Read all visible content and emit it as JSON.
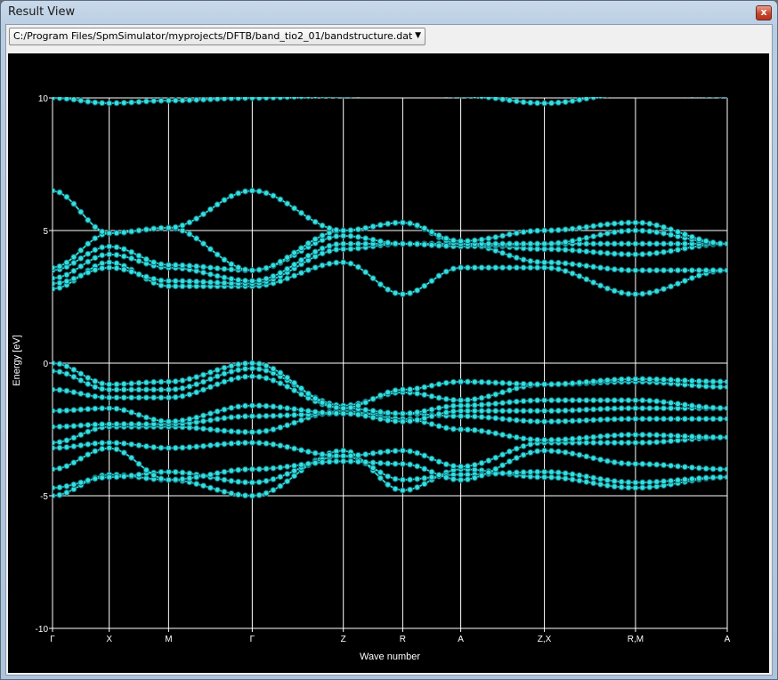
{
  "window": {
    "title": "Result View",
    "close_glyph": "x"
  },
  "file_selector": {
    "selected": "C:/Program Files/SpmSimulator/myprojects/DFTB/band_tio2_01/bandstructure.dat",
    "arrow_glyph": "▼"
  },
  "colors": {
    "background": "#000000",
    "axis": "#ffffff",
    "band": "#33e0e0",
    "marker_edge": "#116b74"
  },
  "chart_data": {
    "type": "line",
    "xlabel": "Wave number",
    "ylabel": "Energy [eV]",
    "ylim": [
      -10,
      10
    ],
    "xlim": [
      0,
      1
    ],
    "yticks": [
      {
        "value": 10,
        "label": "10"
      },
      {
        "value": 5,
        "label": "5"
      },
      {
        "value": 0,
        "label": "0"
      },
      {
        "value": -5,
        "label": "-5"
      },
      {
        "value": -10,
        "label": "-10"
      }
    ],
    "kpoints": [
      {
        "pos": 0.0,
        "label": "Γ"
      },
      {
        "pos": 0.084,
        "label": "X"
      },
      {
        "pos": 0.172,
        "label": "M"
      },
      {
        "pos": 0.296,
        "label": "Γ"
      },
      {
        "pos": 0.431,
        "label": "Z"
      },
      {
        "pos": 0.519,
        "label": "R"
      },
      {
        "pos": 0.605,
        "label": "A"
      },
      {
        "pos": 0.729,
        "label": "Z,X"
      },
      {
        "pos": 0.864,
        "label": "R,M"
      },
      {
        "pos": 1.0,
        "label": "A"
      }
    ],
    "grid": true,
    "bands": [
      [
        -5.0,
        -4.2,
        -4.4,
        -5.0,
        -3.3,
        -4.8,
        -4.0,
        -4.3,
        -4.7,
        -4.3
      ],
      [
        -4.7,
        -4.3,
        -4.1,
        -4.5,
        -3.5,
        -4.4,
        -4.2,
        -4.1,
        -4.5,
        -4.3
      ],
      [
        -4.0,
        -3.2,
        -4.4,
        -4.0,
        -3.7,
        -3.8,
        -4.4,
        -3.3,
        -3.8,
        -4.0
      ],
      [
        -3.2,
        -3.0,
        -3.2,
        -3.0,
        -3.5,
        -3.3,
        -3.9,
        -3.0,
        -3.0,
        -2.8
      ],
      [
        -3.0,
        -2.4,
        -2.4,
        -2.6,
        -1.8,
        -2.1,
        -2.5,
        -2.9,
        -2.7,
        -2.8
      ],
      [
        -2.4,
        -2.3,
        -2.3,
        -2.0,
        -1.9,
        -1.9,
        -2.0,
        -2.2,
        -2.1,
        -2.1
      ],
      [
        -1.8,
        -1.7,
        -2.2,
        -1.6,
        -1.9,
        -2.2,
        -1.8,
        -1.8,
        -1.7,
        -1.7
      ],
      [
        -1.0,
        -1.3,
        -1.3,
        -0.5,
        -1.7,
        -1.9,
        -1.6,
        -1.4,
        -1.4,
        -1.7
      ],
      [
        -0.3,
        -1.0,
        -1.0,
        -0.2,
        -1.6,
        -1.1,
        -1.4,
        -0.8,
        -0.7,
        -0.9
      ],
      [
        0.0,
        -0.8,
        -0.7,
        0.0,
        -1.7,
        -1.0,
        -0.7,
        -0.8,
        -0.6,
        -0.7
      ],
      [
        2.8,
        3.8,
        2.9,
        2.9,
        3.8,
        2.6,
        3.6,
        3.6,
        2.6,
        3.5
      ],
      [
        3.0,
        3.6,
        3.1,
        3.0,
        4.3,
        4.5,
        4.5,
        3.8,
        3.5,
        3.5
      ],
      [
        3.2,
        4.1,
        3.6,
        3.1,
        4.5,
        4.5,
        4.5,
        4.3,
        4.1,
        4.5
      ],
      [
        3.5,
        4.4,
        3.7,
        3.5,
        4.8,
        4.5,
        4.4,
        4.5,
        4.5,
        4.5
      ],
      [
        3.6,
        4.9,
        5.1,
        3.5,
        5.0,
        5.3,
        4.5,
        4.5,
        5.0,
        4.5
      ],
      [
        6.5,
        4.9,
        5.1,
        6.5,
        5.0,
        5.3,
        4.6,
        5.0,
        5.3,
        4.5
      ],
      [
        10.0,
        9.8,
        9.9,
        10.0,
        10.1,
        10.3,
        10.1,
        9.8,
        10.2,
        10.1
      ]
    ]
  }
}
